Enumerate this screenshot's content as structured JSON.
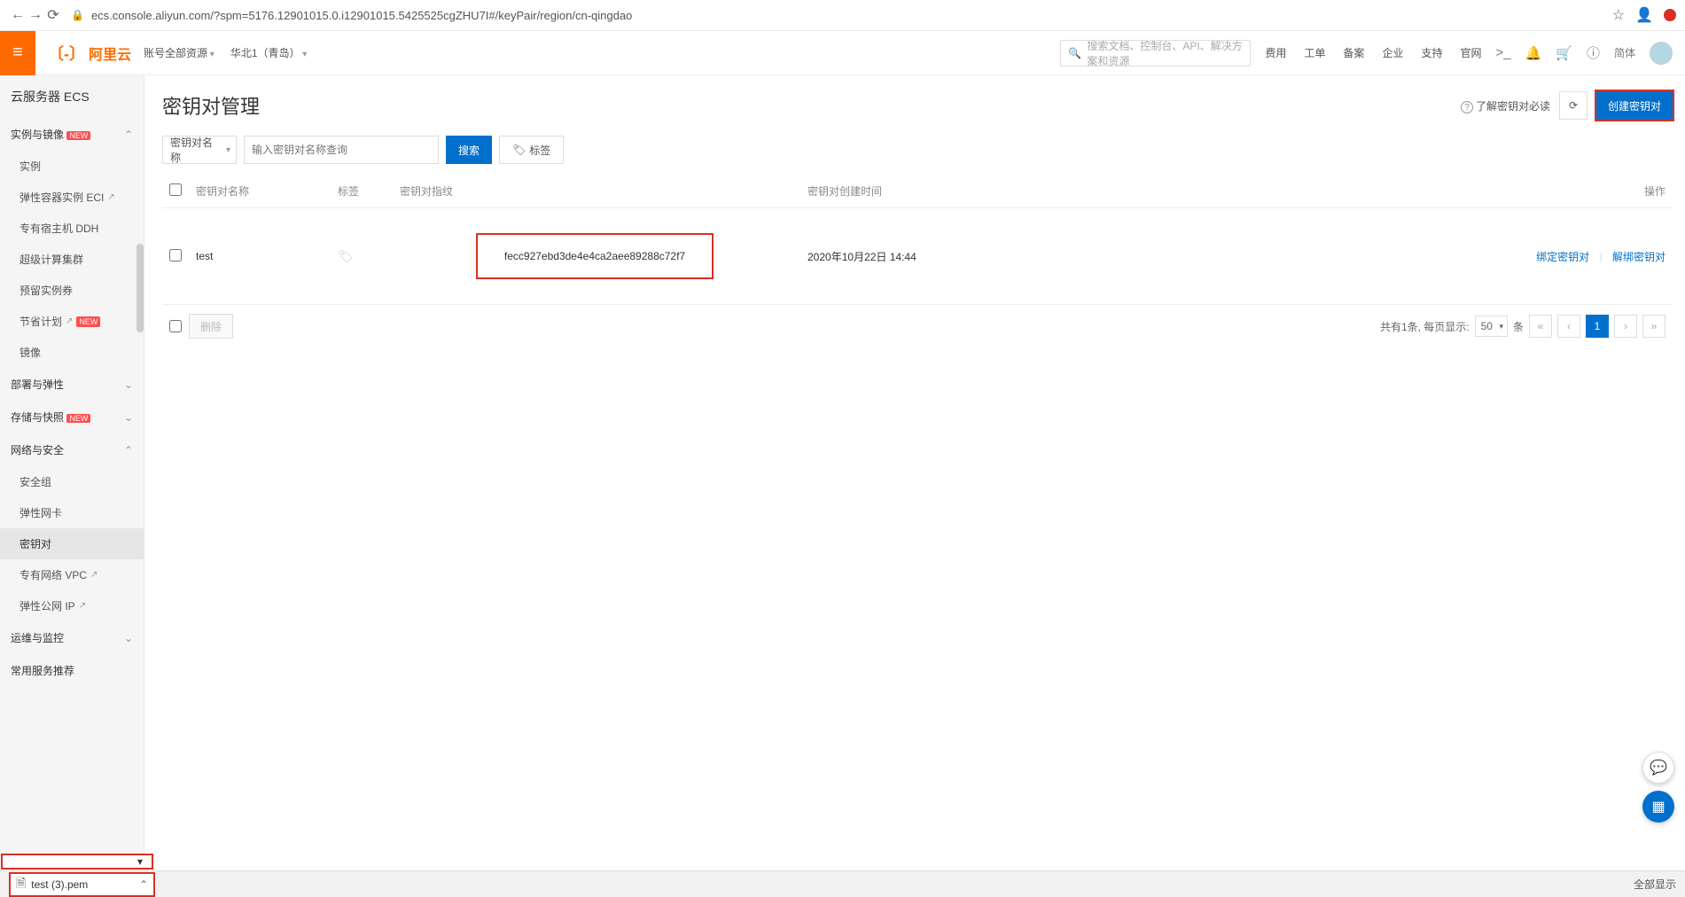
{
  "browser": {
    "url": "ecs.console.aliyun.com/?spm=5176.12901015.0.i12901015.5425525cgZHU7I#/keyPair/region/cn-qingdao"
  },
  "header": {
    "logo": "阿里云",
    "account_dd": "账号全部资源",
    "region_dd": "华北1（青岛）",
    "search_placeholder": "搜索文档、控制台、API、解决方案和资源",
    "links": [
      "费用",
      "工单",
      "备案",
      "企业",
      "支持",
      "官网"
    ],
    "lang": "简体"
  },
  "sidebar": {
    "title": "云服务器 ECS",
    "groups": [
      {
        "label": "实例与镜像",
        "badge": "NEW",
        "open": true,
        "items": [
          {
            "label": "实例"
          },
          {
            "label": "弹性容器实例 ECI",
            "ext": true
          },
          {
            "label": "专有宿主机 DDH"
          },
          {
            "label": "超级计算集群"
          },
          {
            "label": "预留实例券"
          },
          {
            "label": "节省计划",
            "ext": true,
            "badge": "NEW"
          },
          {
            "label": "镜像"
          }
        ]
      },
      {
        "label": "部署与弹性",
        "open": false
      },
      {
        "label": "存储与快照",
        "badge": "NEW",
        "open": false
      },
      {
        "label": "网络与安全",
        "open": true,
        "items": [
          {
            "label": "安全组"
          },
          {
            "label": "弹性网卡"
          },
          {
            "label": "密钥对",
            "active": true
          },
          {
            "label": "专有网络 VPC",
            "ext": true
          },
          {
            "label": "弹性公网 IP",
            "ext": true
          }
        ]
      },
      {
        "label": "运维与监控",
        "open": false
      },
      {
        "label": "常用服务推荐",
        "open": false,
        "no_chev": true
      }
    ]
  },
  "page": {
    "title": "密钥对管理",
    "help": "了解密钥对必读",
    "create_btn": "创建密钥对"
  },
  "toolbar": {
    "filter_label": "密钥对名称",
    "input_placeholder": "输入密钥对名称查询",
    "search_btn": "搜索",
    "tag_btn": "标签"
  },
  "table": {
    "columns": {
      "name": "密钥对名称",
      "tag": "标签",
      "fp": "密钥对指纹",
      "time": "密钥对创建时间",
      "actions": "操作"
    },
    "rows": [
      {
        "name": "test",
        "fp": "fecc927ebd3de4e4ca2aee89288c72f7",
        "time": "2020年10月22日 14:44",
        "action_bind": "绑定密钥对",
        "action_unbind": "解绑密钥对"
      }
    ],
    "delete_btn": "删除",
    "pagination": {
      "summary": "共有1条, 每页显示:",
      "page_size": "50",
      "unit": "条",
      "current": "1"
    }
  },
  "download": {
    "file": "test (3).pem",
    "show_all": "全部显示"
  }
}
